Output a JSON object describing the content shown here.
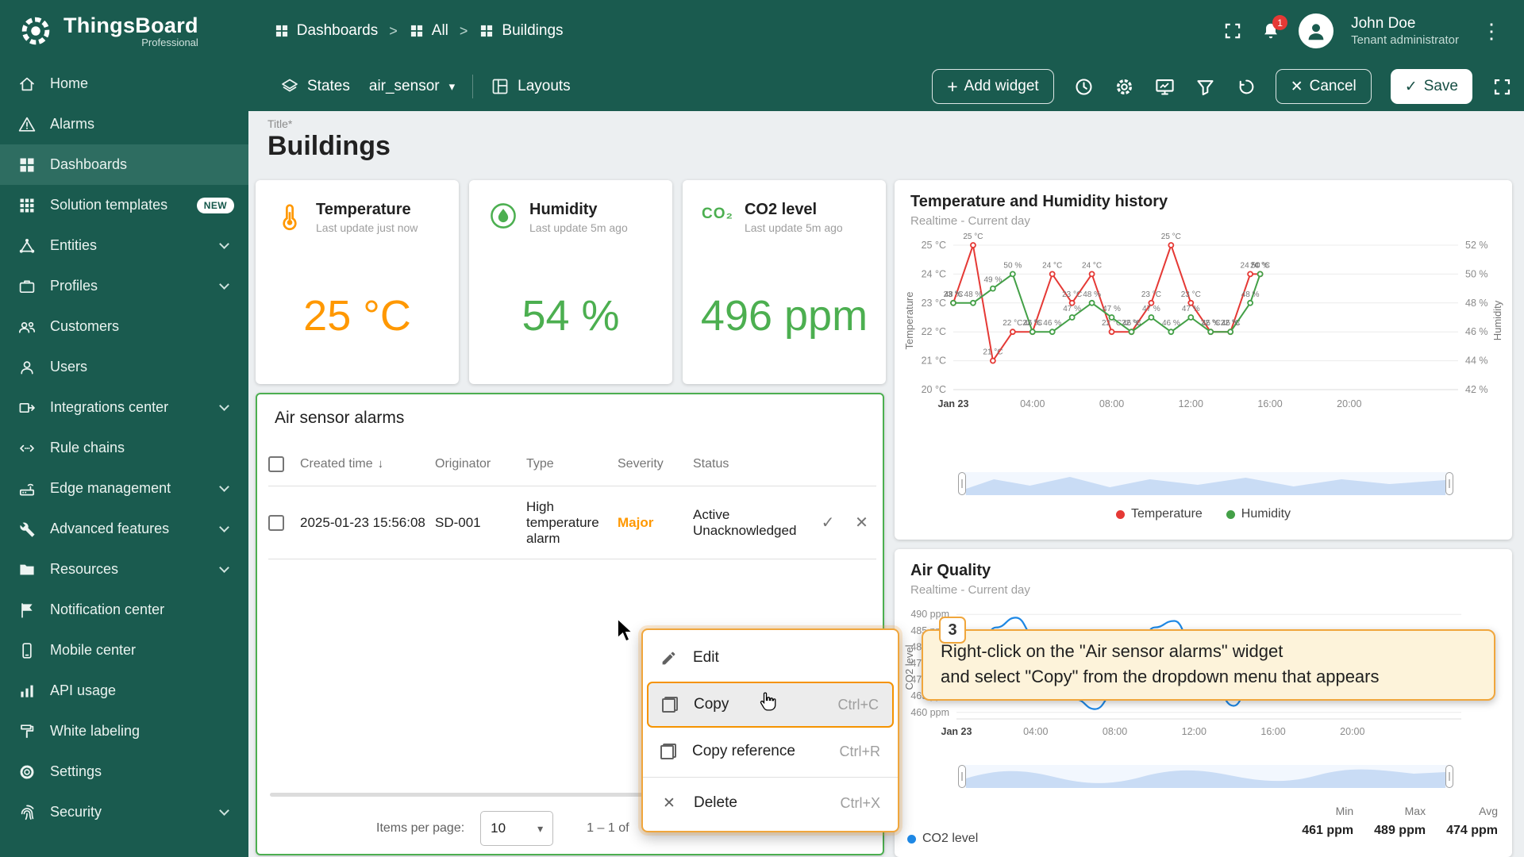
{
  "app": {
    "brand": "ThingsBoard",
    "brand_sub": "Professional",
    "user_name": "John Doe",
    "user_role": "Tenant administrator",
    "notification_count": "1"
  },
  "colors": {
    "sidebar_bg": "#1a5b4f",
    "accent_green": "#4caf50",
    "accent_orange": "#ff9800",
    "severity_major": "#ff9800",
    "temperature_series": "#e53935",
    "humidity_series": "#43a047",
    "co2_series": "#1e88e5",
    "tutorial_highlight": "#f0a63c"
  },
  "icons": {
    "plus": "+",
    "caret_down": "▾",
    "kebab": "⋮",
    "sort_desc": "↓",
    "check": "✓",
    "close": "✕"
  },
  "breadcrumb": {
    "separator": ">",
    "items": [
      "Dashboards",
      "All",
      "Buildings"
    ]
  },
  "toolbar": {
    "states_label": "States",
    "states_value": "air_sensor",
    "layouts_label": "Layouts",
    "add_widget_label": "Add widget",
    "cancel_label": "Cancel",
    "save_label": "Save"
  },
  "sidebar": {
    "items": [
      {
        "label": "Home"
      },
      {
        "label": "Alarms"
      },
      {
        "label": "Dashboards"
      },
      {
        "label": "Solution templates",
        "badge": "NEW"
      },
      {
        "label": "Entities"
      },
      {
        "label": "Profiles"
      },
      {
        "label": "Customers"
      },
      {
        "label": "Users"
      },
      {
        "label": "Integrations center"
      },
      {
        "label": "Rule chains"
      },
      {
        "label": "Edge management"
      },
      {
        "label": "Advanced features"
      },
      {
        "label": "Resources"
      },
      {
        "label": "Notification center"
      },
      {
        "label": "Mobile center"
      },
      {
        "label": "API usage"
      },
      {
        "label": "White labeling"
      },
      {
        "label": "Settings"
      },
      {
        "label": "Security"
      }
    ]
  },
  "page": {
    "title_label": "Title*",
    "title": "Buildings"
  },
  "cards": [
    {
      "title": "Temperature",
      "subtitle": "Last update just now",
      "value": "25 °C"
    },
    {
      "title": "Humidity",
      "subtitle": "Last update 5m ago",
      "value": "54 %"
    },
    {
      "title": "CO2 level",
      "subtitle": "Last update 5m ago",
      "value": "496 ppm",
      "icon_text": "CO₂"
    }
  ],
  "alarms_widget": {
    "title": "Air sensor alarms",
    "columns": [
      "Created time",
      "Originator",
      "Type",
      "Severity",
      "Status"
    ],
    "rows": [
      {
        "created": "2025-01-23 15:56:08",
        "originator": "SD-001",
        "type": "High temperature alarm",
        "severity": "Major",
        "status_line1": "Active",
        "status_line2": "Unacknowledged"
      }
    ],
    "items_per_page_label": "Items per page:",
    "items_per_page_value": "10",
    "range_text": "1 – 1 of"
  },
  "context_menu": {
    "items": [
      {
        "label": "Edit",
        "shortcut": ""
      },
      {
        "label": "Copy",
        "shortcut": "Ctrl+C"
      },
      {
        "label": "Copy reference",
        "shortcut": "Ctrl+R"
      },
      {
        "label": "Delete",
        "shortcut": "Ctrl+X"
      }
    ]
  },
  "annotation": {
    "step": "3",
    "line1": "Right-click on the \"Air sensor alarms\" widget",
    "line2": "and select \"Copy\" from the dropdown menu that appears"
  },
  "chart_data": [
    {
      "type": "line",
      "title": "Temperature and Humidity history",
      "subtitle": "Realtime - Current day",
      "x_hours": [
        0,
        1,
        2,
        3,
        4,
        5,
        6,
        7,
        8,
        9,
        10,
        11,
        12,
        13,
        14,
        15,
        15.5
      ],
      "x_axis": {
        "domain": [
          0,
          25.5
        ],
        "tick_hours": [
          0,
          4,
          8,
          12,
          16,
          20
        ],
        "tick_labels": [
          "Jan 23",
          "04:00",
          "08:00",
          "12:00",
          "16:00",
          "20:00"
        ]
      },
      "y_left": {
        "label": "Temperature",
        "min": 20,
        "max": 25,
        "ticks": [
          "25 °C",
          "24 °C",
          "23 °C",
          "22 °C",
          "21 °C",
          "20 °C"
        ]
      },
      "y_right": {
        "label": "Humidity",
        "min": 42,
        "max": 52,
        "ticks": [
          "52 %",
          "50 %",
          "48 %",
          "46 %",
          "44 %",
          "42 %"
        ]
      },
      "series": [
        {
          "name": "Temperature",
          "unit": "°C",
          "color": "#e53935",
          "axis": "left",
          "values": [
            23,
            25,
            21,
            22,
            22,
            24,
            23,
            24,
            22,
            22,
            23,
            25,
            23,
            22,
            22,
            24,
            24
          ]
        },
        {
          "name": "Humidity",
          "unit": "%",
          "color": "#43a047",
          "axis": "right",
          "values": [
            48,
            48,
            49,
            50,
            46,
            46,
            47,
            48,
            47,
            46,
            47,
            46,
            47,
            46,
            46,
            48,
            50
          ]
        }
      ],
      "legend": [
        "Temperature",
        "Humidity"
      ],
      "legend_position": "bottom"
    },
    {
      "type": "line",
      "title": "Air Quality",
      "subtitle": "Realtime - Current day",
      "x_hours": [
        0,
        1,
        2,
        3,
        4,
        5,
        6,
        7,
        8,
        9,
        10,
        11,
        12,
        13,
        14,
        15,
        15.5
      ],
      "x_axis": {
        "domain": [
          0,
          25.5
        ],
        "tick_hours": [
          0,
          4,
          8,
          12,
          16,
          20
        ],
        "tick_labels": [
          "Jan 23",
          "04:00",
          "08:00",
          "12:00",
          "16:00",
          "20:00"
        ]
      },
      "y": {
        "label": "CO2 level",
        "min": 458,
        "max": 492,
        "tick_values": [
          490,
          485,
          480,
          475,
          470,
          465,
          460
        ],
        "ticks": [
          "490 ppm",
          "485 ppm",
          "480 ppm",
          "475 ppm",
          "470 ppm",
          "465 ppm",
          "460 ppm"
        ]
      },
      "series": [
        {
          "name": "CO2 level",
          "unit": "ppm",
          "color": "#1e88e5",
          "values": [
            470,
            478,
            486,
            489,
            483,
            473,
            464,
            461,
            466,
            476,
            486,
            488,
            480,
            468,
            462,
            471,
            480
          ]
        }
      ],
      "legend": [
        "CO2 level"
      ],
      "legend_position": "bottom-left",
      "stats": {
        "min_label": "Min",
        "min": "461 ppm",
        "max_label": "Max",
        "max": "489 ppm",
        "avg_label": "Avg",
        "avg": "474 ppm"
      }
    }
  ]
}
